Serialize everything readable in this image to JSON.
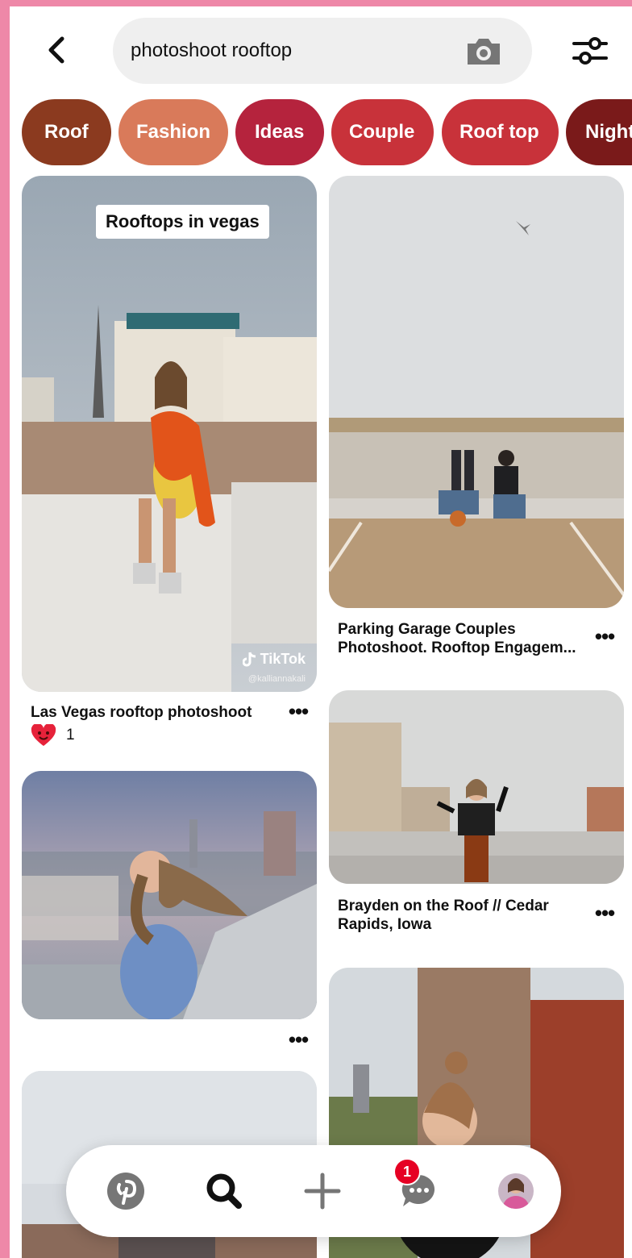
{
  "search": {
    "query": "photoshoot rooftop"
  },
  "icons": {
    "back": "chevron-left-icon",
    "camera": "camera-icon",
    "filter": "sliders-icon"
  },
  "chips": [
    {
      "label": "Roof",
      "color": "#8b3a1f"
    },
    {
      "label": "Fashion",
      "color": "#d97a5a"
    },
    {
      "label": "Ideas",
      "color": "#b5233d"
    },
    {
      "label": "Couple",
      "color": "#c8323a"
    },
    {
      "label": "Roof top",
      "color": "#c8323a"
    },
    {
      "label": "Night",
      "color": "#7a1a1a"
    }
  ],
  "pins": {
    "vegas": {
      "overlay": "Rooftops in vegas",
      "watermark": "TikTok",
      "watermark_handle": "@kalliannakali",
      "title": "Las Vegas rooftop photoshoot",
      "reactions": "1"
    },
    "garage": {
      "title_line1": "Parking Garage Couples",
      "title_line2": "Photoshoot. Rooftop Engagem..."
    },
    "brayden": {
      "title_line1": "Brayden on the Roof // Cedar",
      "title_line2": "Rapids, Iowa"
    },
    "more_dots": "•••"
  },
  "nav": {
    "items": [
      "home-icon",
      "search-icon",
      "create-icon",
      "messages-icon",
      "profile-avatar"
    ],
    "message_badge": "1"
  }
}
